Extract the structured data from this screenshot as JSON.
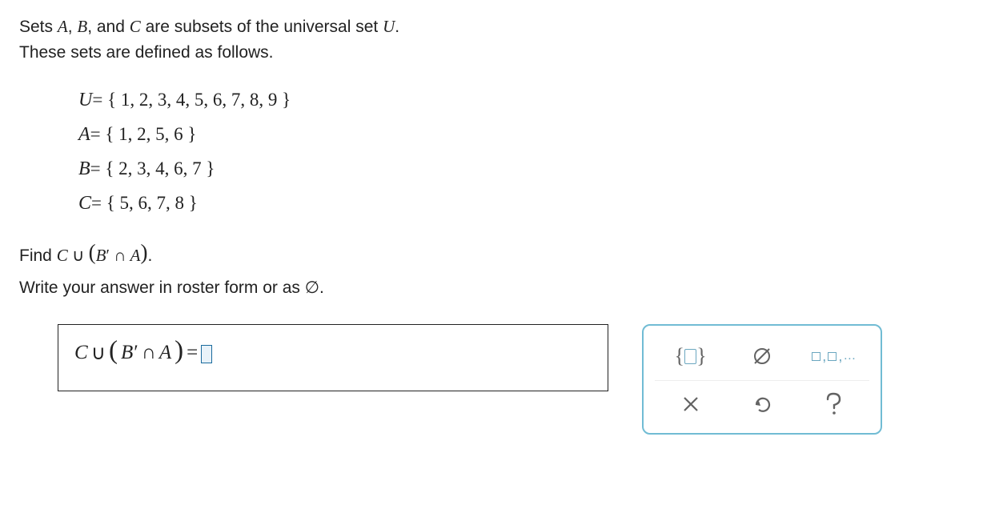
{
  "prompt": {
    "line1_prefix": "Sets ",
    "set_A": "A",
    "comma1": ", ",
    "set_B": "B",
    "comma2": ", and ",
    "set_C": "C",
    "line1_mid": " are subsets of the universal set ",
    "set_U": "U",
    "line1_end": ".",
    "line2": "These sets are defined as follows."
  },
  "sets": {
    "U_label": "U",
    "U_def": "= { 1, 2, 3, 4, 5, 6, 7, 8, 9 }",
    "A_label": "A",
    "A_def": "= { 1, 2, 5, 6 }",
    "B_label": "B",
    "B_def": "= { 2, 3, 4, 6, 7 }",
    "C_label": "C",
    "C_def": "= { 5, 6, 7, 8 }"
  },
  "question": {
    "find_prefix": "Find ",
    "expr_C": "C",
    "expr_union": " ∪ ",
    "expr_lp": "(",
    "expr_B": "B",
    "expr_prime": "′",
    "expr_inter": " ∩ ",
    "expr_A": "A",
    "expr_rp": ")",
    "find_suffix": ".",
    "instruction": "Write your answer in roster form or as ∅."
  },
  "answer": {
    "lhs_C": "C",
    "lhs_union": " ∪ ",
    "lhs_lp": "(",
    "lhs_B": "B",
    "lhs_prime": "′",
    "lhs_inter": " ∩ ",
    "lhs_A": "A",
    "lhs_rp": ")",
    "equals": " = ",
    "value": ""
  },
  "keypad": {
    "braces": "{ }",
    "empty_set": "∅",
    "list": "□,□,…",
    "clear": "×",
    "undo": "↶",
    "help": "?"
  }
}
